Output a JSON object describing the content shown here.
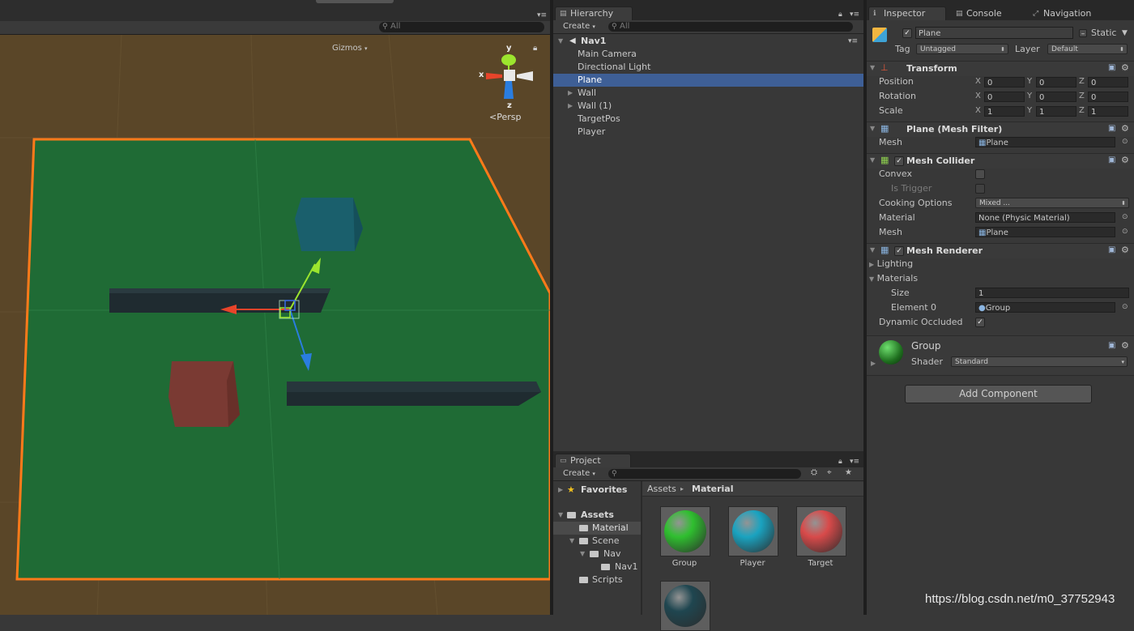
{
  "scene": {
    "gizmos_label": "Gizmos",
    "search_placeholder": "All",
    "persp_label": "Persp",
    "axis_x": "x",
    "axis_y": "y",
    "axis_z": "z",
    "colors": {
      "ground": "#5a4628",
      "plane": "#1f6b35",
      "outline": "#ff7a1a",
      "wall": "#1f2b30",
      "cube_blue": "#1a5f6c",
      "cube_red": "#7a3a33"
    }
  },
  "hierarchy": {
    "tab": "Hierarchy",
    "create_label": "Create",
    "search_placeholder": "All",
    "scene_name": "Nav1",
    "items": [
      {
        "label": "Main Camera",
        "expandable": false,
        "selected": false
      },
      {
        "label": "Directional Light",
        "expandable": false,
        "selected": false
      },
      {
        "label": "Plane",
        "expandable": false,
        "selected": true
      },
      {
        "label": "Wall",
        "expandable": true,
        "selected": false
      },
      {
        "label": "Wall (1)",
        "expandable": true,
        "selected": false
      },
      {
        "label": "TargetPos",
        "expandable": false,
        "selected": false
      },
      {
        "label": "Player",
        "expandable": false,
        "selected": false
      }
    ]
  },
  "project": {
    "tab": "Project",
    "create_label": "Create",
    "favorites_label": "Favorites",
    "assets_label": "Assets",
    "tree": [
      "Material",
      "Scene",
      "Nav",
      "Nav1",
      "Scripts"
    ],
    "breadcrumb": {
      "root": "Assets",
      "separator": "▸",
      "current": "Material"
    },
    "materials": [
      {
        "label": "Group",
        "color": "#2fbf2f"
      },
      {
        "label": "Player",
        "color": "#1aa3c0"
      },
      {
        "label": "Target",
        "color": "#d84a4a"
      },
      {
        "label": "",
        "color": "#1f4650"
      }
    ]
  },
  "inspector": {
    "tabs": [
      "Inspector",
      "Console",
      "Navigation"
    ],
    "object_name": "Plane",
    "static_label": "Static",
    "tag_label": "Tag",
    "tag_value": "Untagged",
    "layer_label": "Layer",
    "layer_value": "Default",
    "transform": {
      "title": "Transform",
      "position_label": "Position",
      "rotation_label": "Rotation",
      "scale_label": "Scale",
      "position": [
        "0",
        "0",
        "0"
      ],
      "rotation": [
        "0",
        "0",
        "0"
      ],
      "scale": [
        "1",
        "1",
        "1"
      ],
      "axis_labels": [
        "X",
        "Y",
        "Z"
      ]
    },
    "mesh_filter": {
      "title": "Plane (Mesh Filter)",
      "mesh_label": "Mesh",
      "mesh_value": "Plane"
    },
    "mesh_collider": {
      "title": "Mesh Collider",
      "convex_label": "Convex",
      "is_trigger_label": "Is Trigger",
      "cooking_label": "Cooking Options",
      "cooking_value": "Mixed ...",
      "material_label": "Material",
      "material_value": "None (Physic Material)",
      "mesh_label": "Mesh",
      "mesh_value": "Plane"
    },
    "mesh_renderer": {
      "title": "Mesh Renderer",
      "lighting_label": "Lighting",
      "materials_label": "Materials",
      "size_label": "Size",
      "size_value": "1",
      "element_label": "Element 0",
      "element_value": "Group",
      "dynamic_label": "Dynamic Occluded"
    },
    "material": {
      "name": "Group",
      "shader_label": "Shader",
      "shader_value": "Standard"
    },
    "add_component": "Add Component"
  },
  "watermark": "https://blog.csdn.net/m0_37752943"
}
